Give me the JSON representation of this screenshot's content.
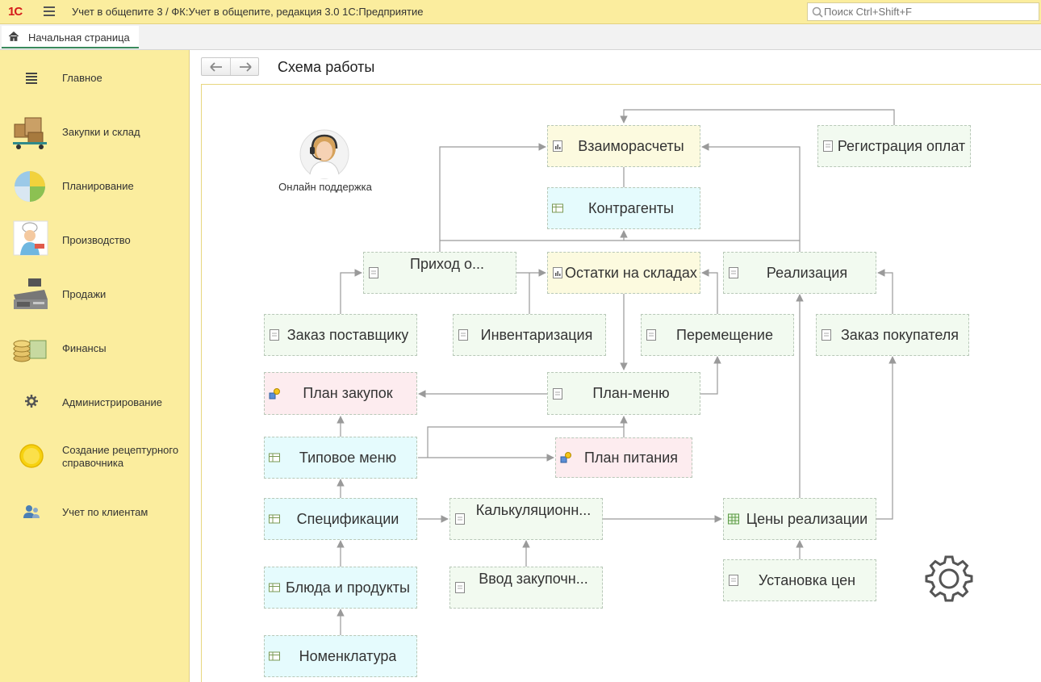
{
  "window": {
    "logo": "1С",
    "title": "Учет в общепите 3 / ФК:Учет в общепите, редакция 3.0 1С:Предприятие",
    "search_placeholder": "Поиск Ctrl+Shift+F"
  },
  "tabs": [
    {
      "label": "Начальная страница"
    }
  ],
  "sidebar": {
    "items": [
      {
        "label": "Главное",
        "icon": "menu-lines-icon"
      },
      {
        "label": "Закупки и склад",
        "icon": "boxes-cart-icon"
      },
      {
        "label": "Планирование",
        "icon": "pie-chart-icon"
      },
      {
        "label": "Производство",
        "icon": "chef-icon"
      },
      {
        "label": "Продажи",
        "icon": "cash-register-icon"
      },
      {
        "label": "Финансы",
        "icon": "coins-icon"
      },
      {
        "label": "Администрирование",
        "icon": "gear-small-icon"
      },
      {
        "label": "Создание рецептурного справочника",
        "icon": "yellow-circle-icon"
      },
      {
        "label": "Учет по клиентам",
        "icon": "users-icon"
      }
    ]
  },
  "main": {
    "title": "Схема работы",
    "support_label": "Онлайн поддержка",
    "nodes": {
      "vzaimoraschety": "Взаиморасчеты",
      "registraciya_oplat": "Регистрация оплат",
      "kontragenty": "Контрагенты",
      "prihod": "Приход о...",
      "ostatki": "Остатки на складах",
      "realizaciya": "Реализация",
      "zakaz_postavshiku": "Заказ поставщику",
      "inventarizaciya": "Инвентаризация",
      "peremeshenie": "Перемещение",
      "zakaz_pokupatelya": "Заказ покупателя",
      "plan_zakupok": "План закупок",
      "plan_menu": "План-меню",
      "tipovoe_menu": "Типовое меню",
      "plan_pitaniya": "План питания",
      "specifikacii": "Спецификации",
      "kalkulyacionn": "Калькуляционн...",
      "ceny_realizacii": "Цены реализации",
      "bluda": "Блюда и продукты",
      "vvod_zakupochn": "Ввод закупочн...",
      "ustanovka_cen": "Установка цен",
      "nomenklatura": "Номенклатура"
    }
  },
  "colors": {
    "titlebar": "#fbed9e",
    "sidebar": "#fbed9e",
    "node_green": "#f2faf0",
    "node_yellow": "#fcfadf",
    "node_cyan": "#e5fbfd",
    "node_pink": "#fdecef",
    "edge": "#9a9a9a"
  }
}
